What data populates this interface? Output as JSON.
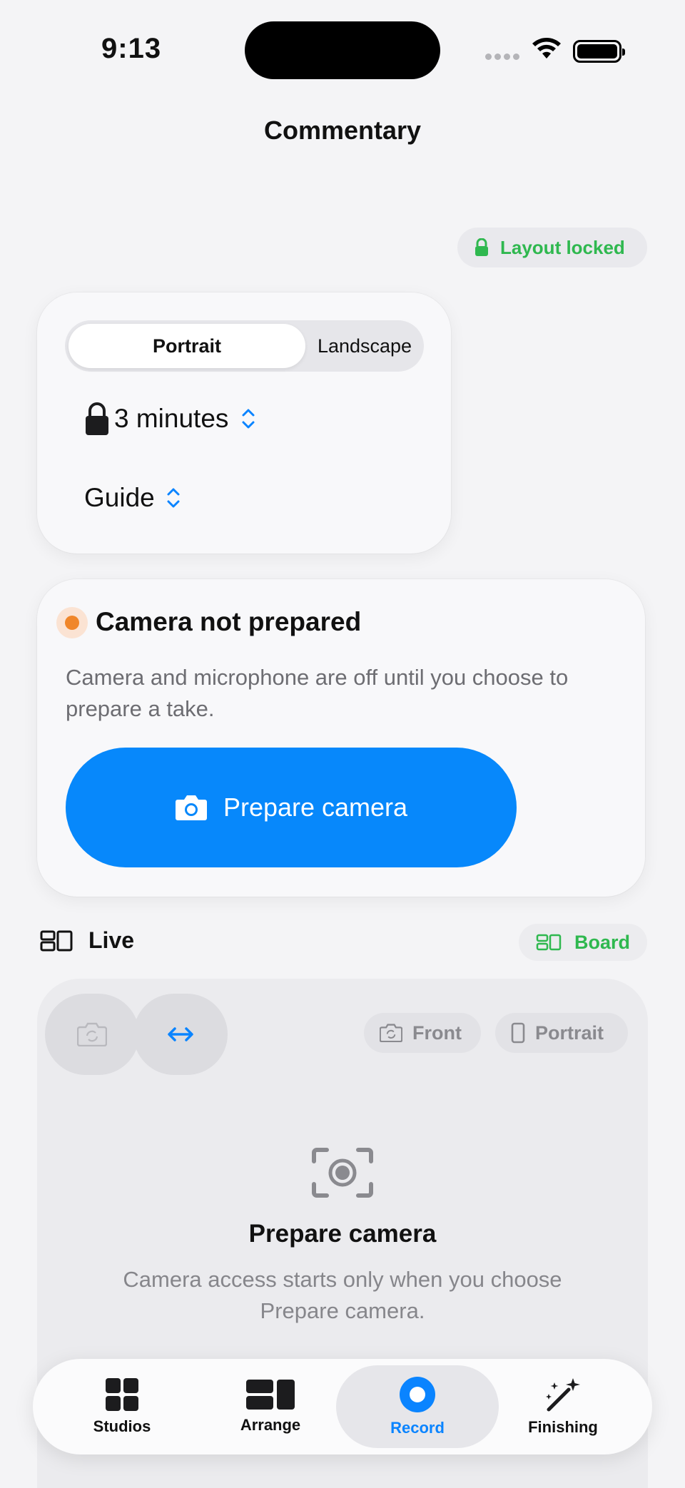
{
  "status_bar": {
    "time": "9:13"
  },
  "nav": {
    "title": "Commentary"
  },
  "layout_lock": {
    "label": "Layout locked",
    "color": "#2fb84f"
  },
  "format": {
    "orientation_options": [
      "Portrait",
      "Landscape"
    ],
    "selected_orientation": "Portrait",
    "duration": "3 minutes",
    "guide": "Guide"
  },
  "camera_status": {
    "title": "Camera not prepared",
    "description": "Camera and microphone are off until you choose to prepare a take.",
    "button_label": "Prepare camera",
    "status_color": "#f0862a",
    "accent_color": "#0788fb"
  },
  "live_section": {
    "label": "Live",
    "board_label": "Board"
  },
  "preview": {
    "chip_camera": "Front",
    "chip_orientation": "Portrait",
    "title": "Prepare camera",
    "description": "Camera access starts only when you choose Prepare camera."
  },
  "tabs": [
    {
      "label": "Studios",
      "icon": "grid-icon"
    },
    {
      "label": "Arrange",
      "icon": "arrange-icon"
    },
    {
      "label": "Record",
      "icon": "record-icon",
      "selected": true
    },
    {
      "label": "Finishing",
      "icon": "magic-wand-icon"
    }
  ]
}
